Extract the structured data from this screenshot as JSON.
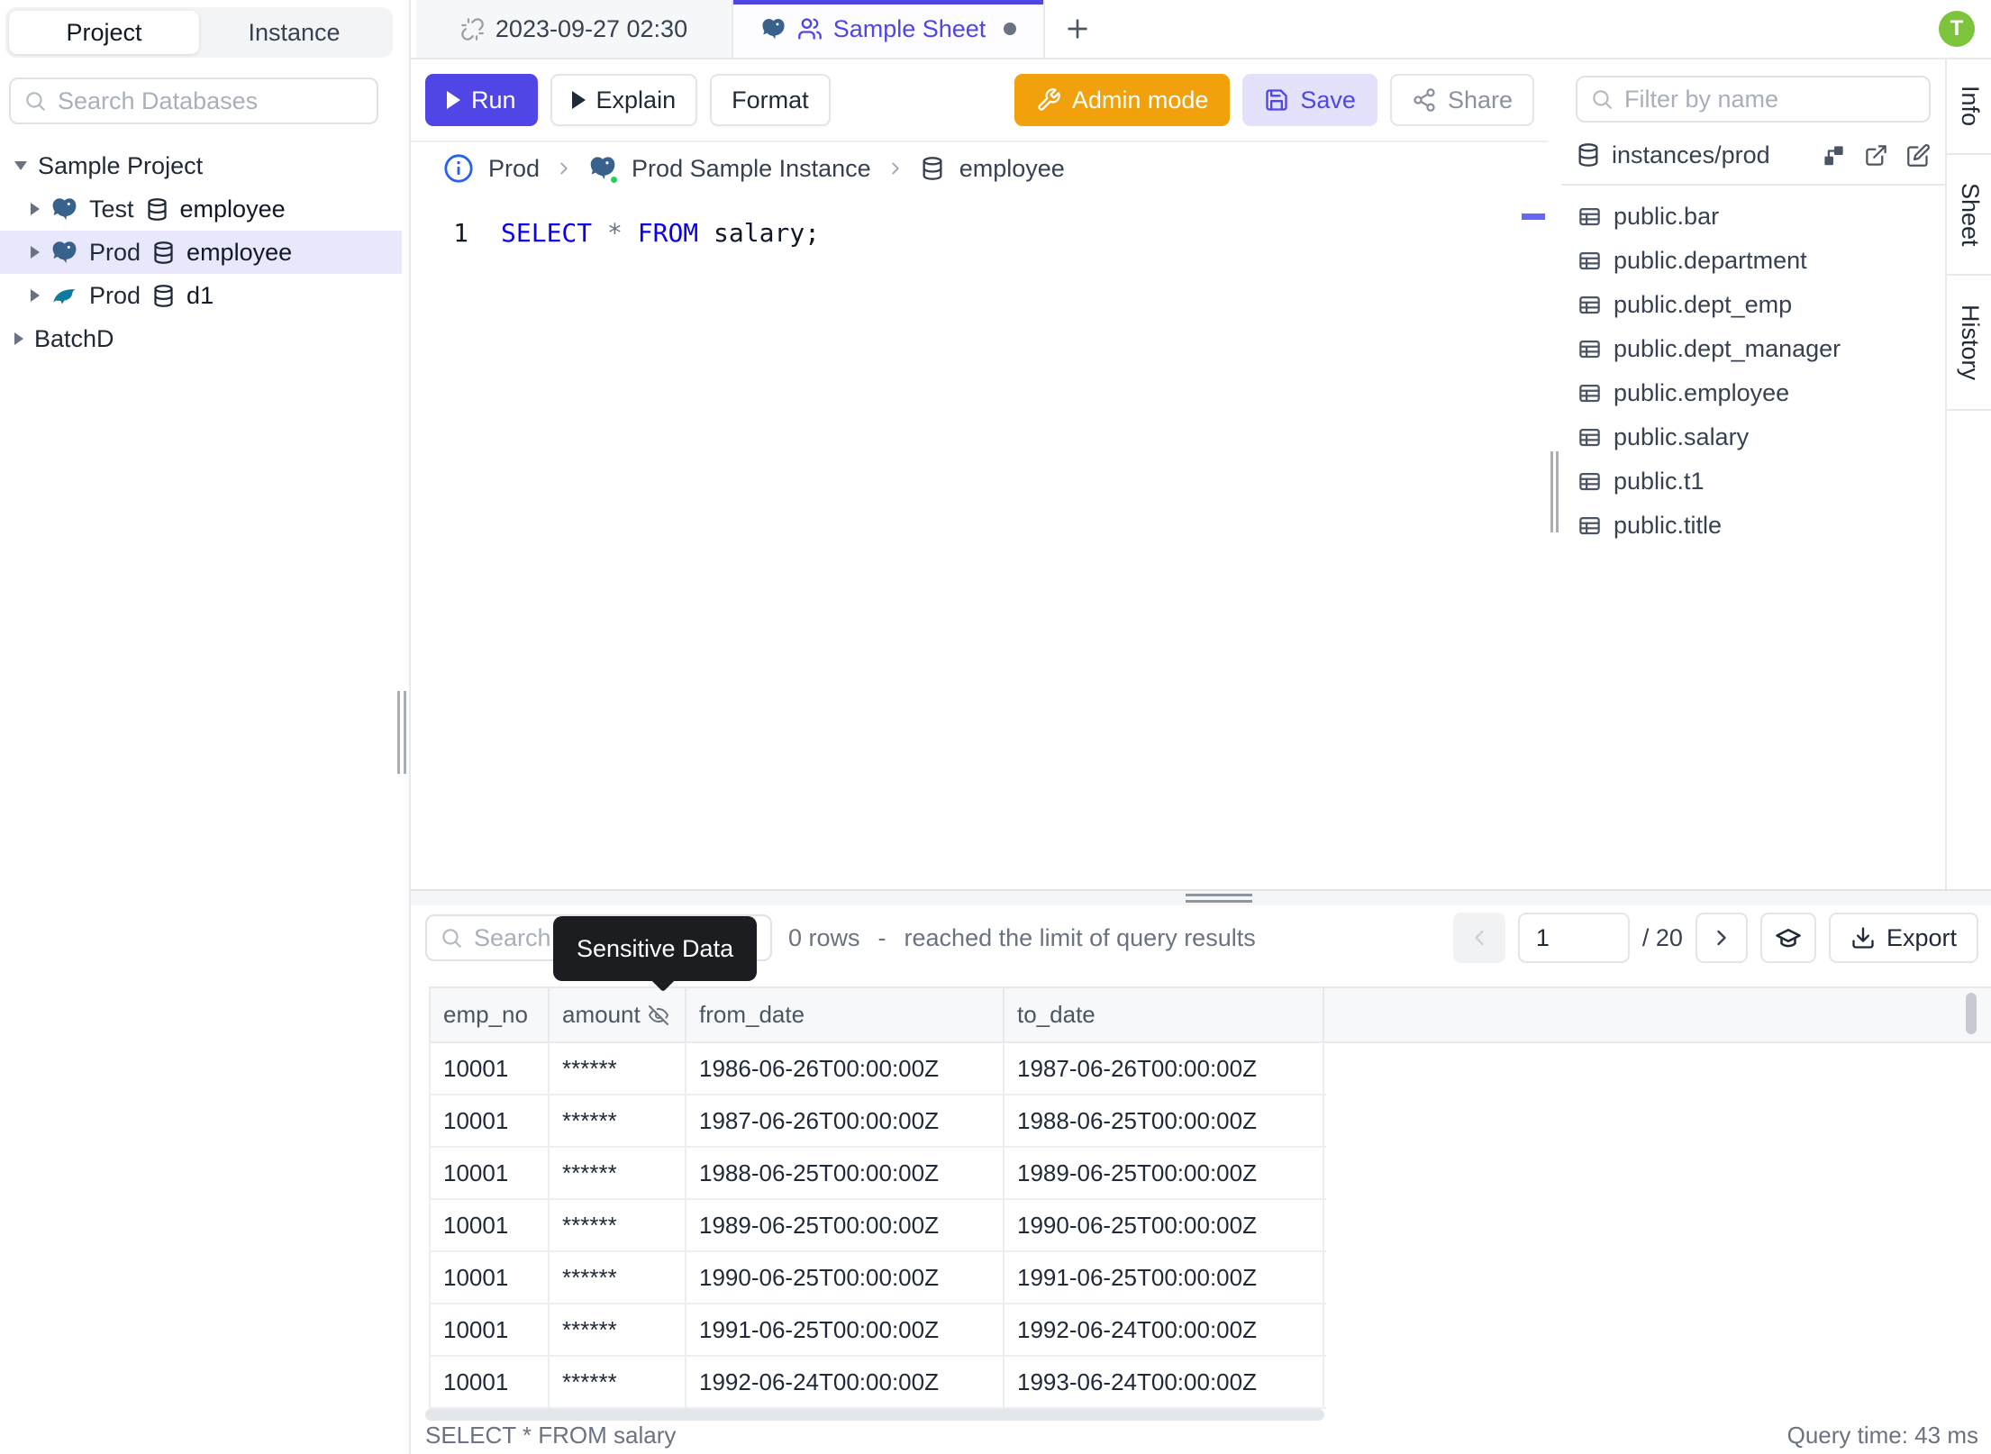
{
  "left_sidebar": {
    "toggle": {
      "project": "Project",
      "instance": "Instance"
    },
    "search_placeholder": "Search Databases",
    "tree": {
      "project_label": "Sample Project",
      "items": [
        {
          "env": "Test",
          "engine": "postgres",
          "db": "employee"
        },
        {
          "env": "Prod",
          "engine": "postgres",
          "db": "employee"
        },
        {
          "env": "Prod",
          "engine": "mysql",
          "db": "d1"
        }
      ],
      "collapsed_project": "BatchD"
    }
  },
  "tab_bar": {
    "history_tab": "2023-09-27 02:30",
    "sheet_tab": "Sample Sheet",
    "avatar_initial": "T"
  },
  "toolbar": {
    "run": "Run",
    "explain": "Explain",
    "format": "Format",
    "admin_mode": "Admin mode",
    "save": "Save",
    "share": "Share"
  },
  "breadcrumb": {
    "env": "Prod",
    "instance": "Prod Sample Instance",
    "database": "employee"
  },
  "editor": {
    "line_number": "1",
    "kw1": "SELECT",
    "star": "*",
    "kw2": "FROM",
    "rest": " salary;"
  },
  "right_sidebar": {
    "filter_placeholder": "Filter by name",
    "header": "instances/prod",
    "tables": [
      "public.bar",
      "public.department",
      "public.dept_emp",
      "public.dept_manager",
      "public.employee",
      "public.salary",
      "public.t1",
      "public.title"
    ]
  },
  "side_strip": {
    "tabs": [
      "Info",
      "Sheet",
      "History"
    ]
  },
  "results": {
    "search_placeholder": "Search",
    "tooltip": "Sensitive Data",
    "rows_count": "0 rows",
    "separator": "-",
    "limit_message": "reached the limit of query results",
    "pagination": {
      "current": "1",
      "total": "/ 20"
    },
    "export_label": "Export",
    "columns": [
      "emp_no",
      "amount",
      "from_date",
      "to_date"
    ],
    "rows": [
      {
        "emp_no": "10001",
        "amount": "******",
        "from_date": "1986-06-26T00:00:00Z",
        "to_date": "1987-06-26T00:00:00Z"
      },
      {
        "emp_no": "10001",
        "amount": "******",
        "from_date": "1987-06-26T00:00:00Z",
        "to_date": "1988-06-25T00:00:00Z"
      },
      {
        "emp_no": "10001",
        "amount": "******",
        "from_date": "1988-06-25T00:00:00Z",
        "to_date": "1989-06-25T00:00:00Z"
      },
      {
        "emp_no": "10001",
        "amount": "******",
        "from_date": "1989-06-25T00:00:00Z",
        "to_date": "1990-06-25T00:00:00Z"
      },
      {
        "emp_no": "10001",
        "amount": "******",
        "from_date": "1990-06-25T00:00:00Z",
        "to_date": "1991-06-25T00:00:00Z"
      },
      {
        "emp_no": "10001",
        "amount": "******",
        "from_date": "1991-06-25T00:00:00Z",
        "to_date": "1992-06-24T00:00:00Z"
      },
      {
        "emp_no": "10001",
        "amount": "******",
        "from_date": "1992-06-24T00:00:00Z",
        "to_date": "1993-06-24T00:00:00Z"
      }
    ],
    "statement": "SELECT * FROM salary",
    "query_time": "Query time: 43 ms"
  },
  "colors": {
    "accent_indigo": "#4f46e5",
    "admin_orange": "#f0a10c",
    "avatar_green": "#7cc43c",
    "keyword_blue": "#0b00e8",
    "selected_row_bg": "#e9e7fc",
    "tooltip_bg": "#1b1d21"
  }
}
